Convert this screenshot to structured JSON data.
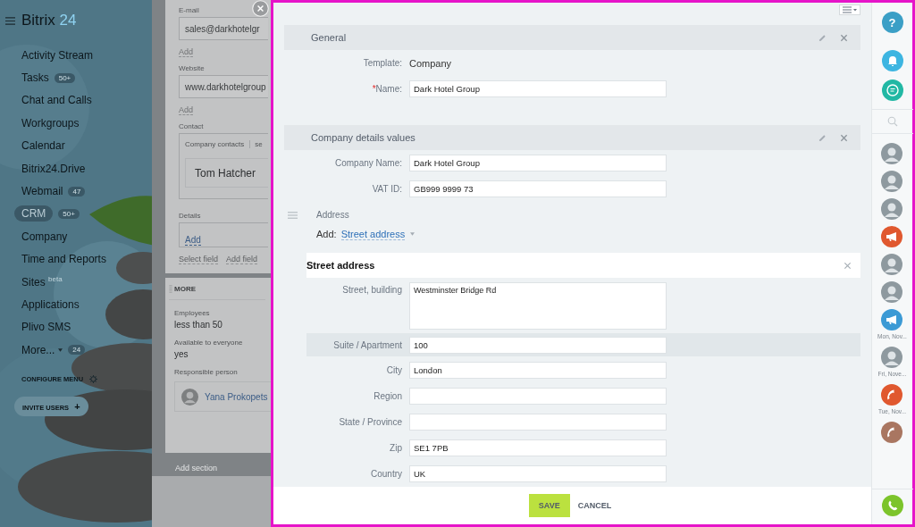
{
  "sidebar": {
    "logo": {
      "name": "Bitrix",
      "number": "24"
    },
    "items": [
      {
        "label": "Activity Stream",
        "selected": false
      },
      {
        "label": "Tasks",
        "badge": "50+",
        "selected": false
      },
      {
        "label": "Chat and Calls",
        "selected": false
      },
      {
        "label": "Workgroups",
        "selected": false
      },
      {
        "label": "Calendar",
        "selected": false
      },
      {
        "label": "Bitrix24.Drive",
        "selected": false
      },
      {
        "label": "Webmail",
        "badge": "47",
        "selected": false
      },
      {
        "label": "CRM",
        "badge": "50+",
        "selected": true
      },
      {
        "label": "Company",
        "selected": false
      },
      {
        "label": "Time and Reports",
        "selected": false
      },
      {
        "label": "Sites $^{beta}$",
        "selected": false
      },
      {
        "label": "Applications",
        "selected": false
      },
      {
        "label": "Plivo SMS",
        "selected": false
      },
      {
        "label": "More...",
        "badge": "24",
        "kind": "menu",
        "selected": false
      }
    ],
    "configure": "CONFIGURE MENU",
    "invite": "INVITE USERS",
    "invite_icon": "+"
  },
  "background_page": {
    "fields": [
      {
        "kind": "input",
        "label": "E-mail",
        "value": "sales@darkhotelgr",
        "link": "Add"
      },
      {
        "kind": "input",
        "label": "Website",
        "value": "www.darkhotelgroup",
        "link": "Add"
      },
      {
        "kind": "contacts",
        "label": "Contact",
        "tab": "Company contacts",
        "tab_2": "se",
        "name": "Tom Hatcher"
      },
      {
        "kind": "details",
        "label": "Details",
        "link": "Add"
      }
    ],
    "actions": [
      "Select field",
      "Add field"
    ],
    "more": {
      "title": "MORE",
      "fields": [
        {
          "label": "Employees",
          "value": "less than 50"
        },
        {
          "label": "Available to everyone",
          "value": "yes"
        },
        {
          "label": "Responsible person",
          "person": "Yana Prokopets"
        }
      ]
    },
    "add_section": "Add section"
  },
  "panel": {
    "sections": [
      {
        "title": "General",
        "rows": [
          {
            "kind": "text",
            "label": "Template:",
            "value": "Company"
          },
          {
            "kind": "input",
            "label": "Name:",
            "required_mark": "*",
            "value": "Dark Hotel Group"
          }
        ]
      },
      {
        "title": "Company details values",
        "rows": [
          {
            "kind": "input",
            "label": "Company Name:",
            "value": "Dark Hotel Group"
          },
          {
            "kind": "input",
            "label": "VAT ID:",
            "value": "GB999 9999 73"
          }
        ],
        "address": {
          "label": "Address",
          "add_label": "Add:",
          "add_link": "Street address",
          "block": {
            "title": "Street address",
            "rows": [
              {
                "kind": "textarea",
                "label": "Street, building",
                "value": "Westminster Bridge Rd",
                "highlighted": false
              },
              {
                "kind": "input",
                "label": "Suite / Apartment",
                "value": "100",
                "highlighted": true
              },
              {
                "kind": "input",
                "label": "City",
                "value": "London",
                "highlighted": false
              },
              {
                "kind": "input",
                "label": "Region",
                "highlighted": false
              },
              {
                "kind": "input",
                "label": "State / Province",
                "highlighted": false
              },
              {
                "kind": "input",
                "label": "Zip",
                "value": "SE1 7PB",
                "highlighted": false
              },
              {
                "kind": "input",
                "label": "Country",
                "value": "UK",
                "highlighted": false
              }
            ]
          }
        }
      }
    ],
    "buttons": [
      {
        "label": "SAVE",
        "kind": "primary"
      },
      {
        "label": "CANCEL",
        "kind": "link"
      }
    ]
  },
  "rightbar": {
    "top": [
      {
        "kind": "help",
        "label": "?",
        "color": "#3b9fc6"
      },
      {
        "kind": "bell",
        "color": "#3db5e1"
      },
      {
        "kind": "chat",
        "color": "#22b8a4"
      }
    ],
    "contacts": [
      {
        "kind": "person"
      },
      {
        "kind": "person"
      },
      {
        "kind": "person"
      },
      {
        "kind": "megaphone",
        "color": "#e0582f"
      },
      {
        "kind": "person"
      },
      {
        "kind": "person"
      },
      {
        "kind": "megaphone",
        "color": "#3c9ad5",
        "date": "Mon, Nov..."
      },
      {
        "kind": "person",
        "date": "Fri, Nove..."
      },
      {
        "kind": "phone",
        "color": "#e0582f",
        "date": "Tue, Nov..."
      },
      {
        "kind": "phone",
        "color": "#a97661"
      }
    ]
  }
}
